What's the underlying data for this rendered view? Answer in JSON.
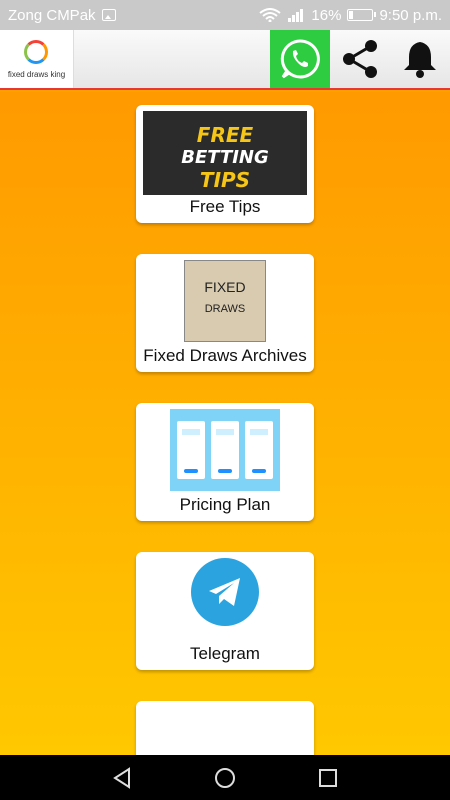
{
  "status_bar": {
    "carrier": "Zong CMPak",
    "battery": "16%",
    "time": "9:50 p.m.",
    "battery_level": 0.16
  },
  "app_bar": {
    "logo_text": "fixed draws king",
    "whatsapp_icon": "whatsapp-icon",
    "share_icon": "share-icon",
    "bell_icon": "bell-icon",
    "accent_color": "#e53935",
    "whatsapp_color": "#2ecc40"
  },
  "cards": [
    {
      "label": "Free Tips",
      "image_text": [
        "FREE",
        "BETTING",
        "TIPS"
      ]
    },
    {
      "label": "Fixed Draws Archives",
      "image_text": [
        "FIXED",
        "DRAWS"
      ]
    },
    {
      "label": "Pricing Plan"
    },
    {
      "label": "Telegram",
      "icon": "telegram-icon"
    },
    {
      "label": ""
    }
  ],
  "background": {
    "top_color": "#ff9a00",
    "bottom_color": "#ffc800"
  },
  "nav_bar": {
    "back_icon": "back-icon",
    "home_icon": "home-icon",
    "recents_icon": "recents-icon"
  }
}
